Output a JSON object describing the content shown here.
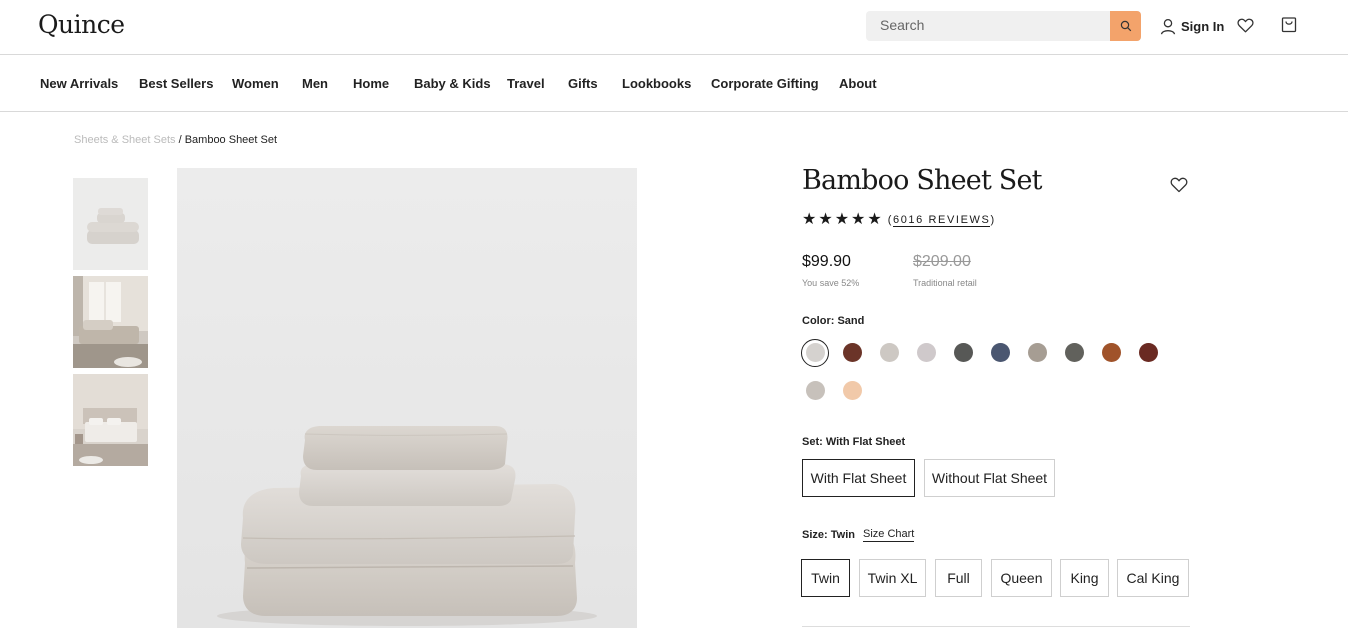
{
  "header": {
    "logo": "Quince",
    "search_placeholder": "Search",
    "signin_label": "Sign In"
  },
  "nav": {
    "items": [
      "New Arrivals",
      "Best Sellers",
      "Women",
      "Men",
      "Home",
      "Baby & Kids",
      "Travel",
      "Gifts",
      "Lookbooks",
      "Corporate Gifting",
      "About"
    ]
  },
  "breadcrumb": {
    "parent": "Sheets & Sheet Sets",
    "separator": "/",
    "current": "Bamboo Sheet Set"
  },
  "product": {
    "title": "Bamboo Sheet Set",
    "rating": 5,
    "reviews_open": "(",
    "reviews_text": "6016 REVIEWS",
    "reviews_close": ")",
    "price": "$99.90",
    "savings": "You save 52%",
    "retail_price": "$209.00",
    "retail_label": "Traditional retail"
  },
  "color": {
    "label": "Color: Sand",
    "selected_index": 0,
    "swatches": [
      "#d5d2cf",
      "#6b3428",
      "#cdc8c3",
      "#cfc9cb",
      "#575856",
      "#4a5670",
      "#a69d93",
      "#61615c",
      "#a0532a",
      "#6a2a22",
      "#c7c1bb",
      "#f1c9a9"
    ]
  },
  "set": {
    "label": "Set: With Flat Sheet",
    "options": [
      "With Flat Sheet",
      "Without Flat Sheet"
    ],
    "selected_index": 0
  },
  "size": {
    "label": "Size: Twin",
    "chart_link": "Size Chart",
    "options": [
      "Twin",
      "Twin XL",
      "Full",
      "Queen",
      "King",
      "Cal King"
    ],
    "selected_index": 0
  },
  "icons": {
    "search": "search-icon",
    "user": "user-icon",
    "wishlist": "heart-icon",
    "cart": "shopping-bag-icon",
    "star": "star-icon"
  }
}
